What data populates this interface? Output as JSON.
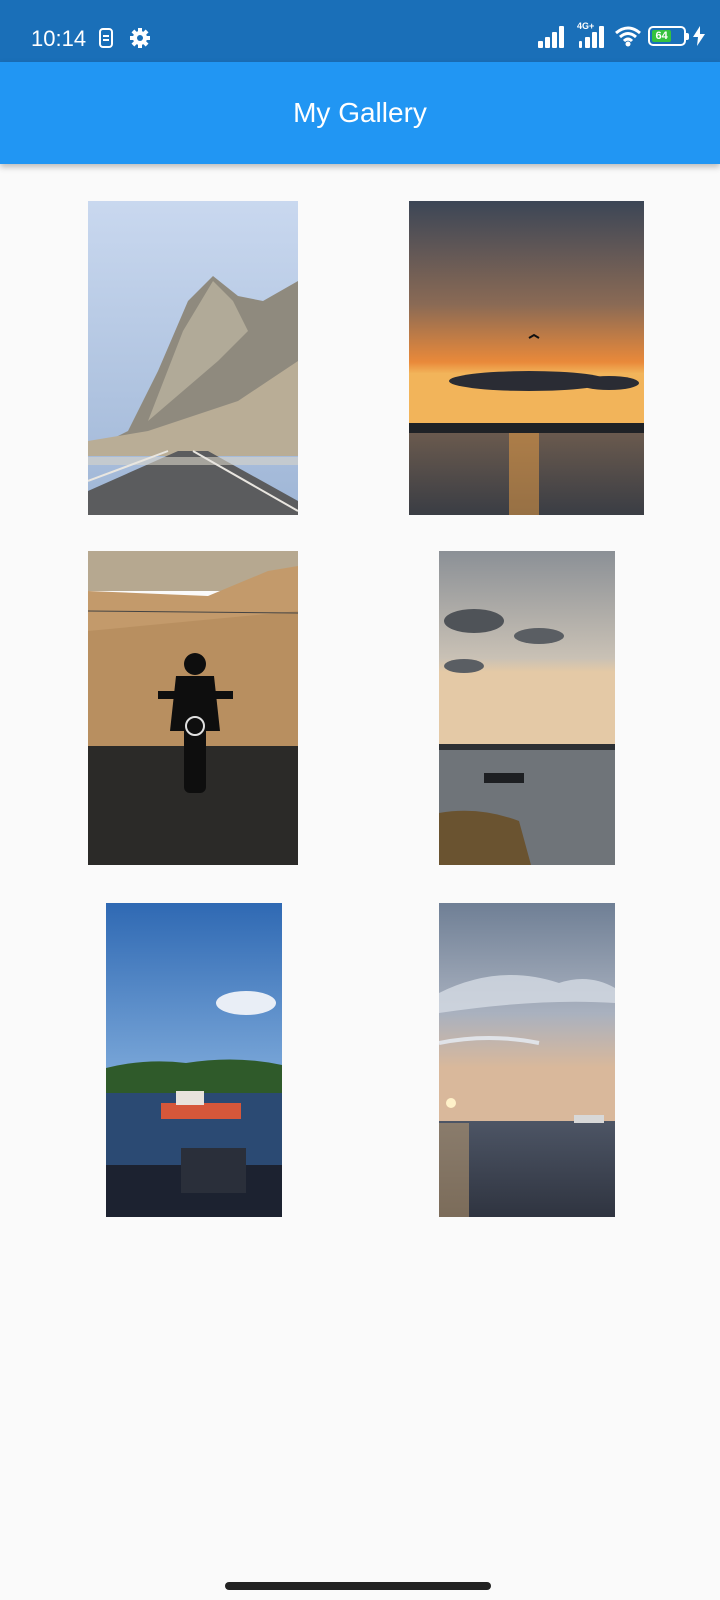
{
  "status_bar": {
    "time": "10:14",
    "network_label": "4G+",
    "battery_level": "64",
    "battery_percent": 64,
    "icons": [
      "sim-card-icon",
      "gear-icon",
      "signal-icon",
      "signal-4g-icon",
      "wifi-icon",
      "battery-icon",
      "charging-bolt-icon"
    ]
  },
  "app_bar": {
    "title": "My Gallery",
    "color": "#2196f3"
  },
  "gallery": {
    "photos": [
      {
        "subject": "mountain-road"
      },
      {
        "subject": "sunset-over-water"
      },
      {
        "subject": "motorcycle-rider"
      },
      {
        "subject": "boat-at-dusk"
      },
      {
        "subject": "red-tugboat"
      },
      {
        "subject": "sea-sunset"
      }
    ]
  },
  "colors": {
    "status_bar": "#1a6fb8",
    "background": "#fafafa",
    "battery_fill": "#35c23f"
  }
}
